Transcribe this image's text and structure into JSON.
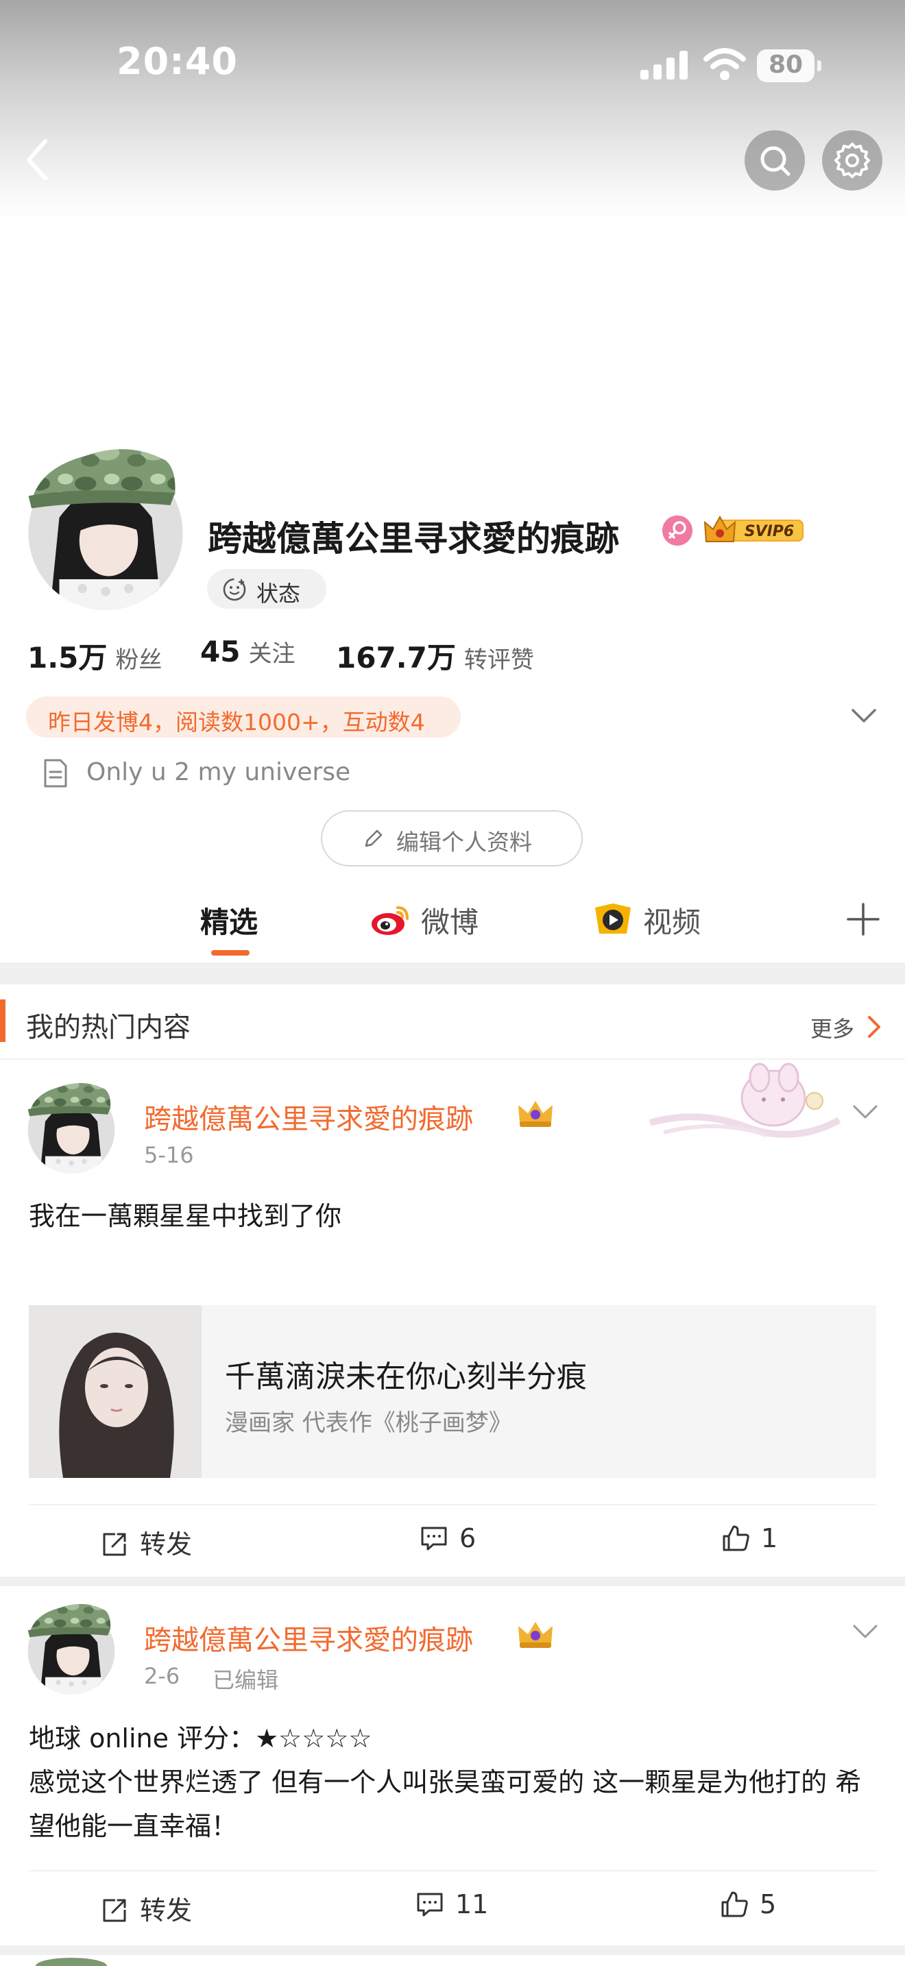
{
  "status_bar": {
    "time": "20:40",
    "battery": "80"
  },
  "profile": {
    "name": "跨越億萬公里寻求愛的痕跡",
    "vip_badge": "SVIP6",
    "status_label": "状态",
    "stats": [
      {
        "value": "1.5万",
        "label": "粉丝"
      },
      {
        "value": "45",
        "label": "关注"
      },
      {
        "value": "167.7万",
        "label": "转评赞"
      }
    ],
    "activity": "昨日发博4，阅读数1000+，互动数4",
    "bio": "Only u 2 my universe",
    "edit_button": "编辑个人资料"
  },
  "tabs": [
    {
      "label": "精选",
      "active": true
    },
    {
      "label": "微博",
      "icon": "weibo-icon"
    },
    {
      "label": "视频",
      "icon": "video-icon"
    }
  ],
  "hot_section": {
    "title": "我的热门内容",
    "more": "更多"
  },
  "posts": [
    {
      "author": "跨越億萬公里寻求愛的痕跡",
      "time": "5-16",
      "text": "我在一萬顆星星中找到了你",
      "card": {
        "title": "千萬滴淚未在你心刻半分痕",
        "subtitle": "漫画家 代表作《桃子画梦》"
      },
      "actions": {
        "repost": "转发",
        "comments": "6",
        "likes": "1"
      }
    },
    {
      "author": "跨越億萬公里寻求愛的痕跡",
      "time": "2-6",
      "edited": "已编辑",
      "rating_line": "地球 online 评分：★☆☆☆☆",
      "body": "感觉这个世界烂透了 但有一个人叫张昊蛮可爱的 这一颗星是为他打的 希望他能一直幸福！",
      "actions": {
        "repost": "转发",
        "comments": "11",
        "likes": "5"
      }
    }
  ],
  "colors": {
    "accent": "#f26a2e",
    "activity_bg": "#fdece4",
    "band": "#f0f0f0",
    "text": "#1a1a1a"
  }
}
